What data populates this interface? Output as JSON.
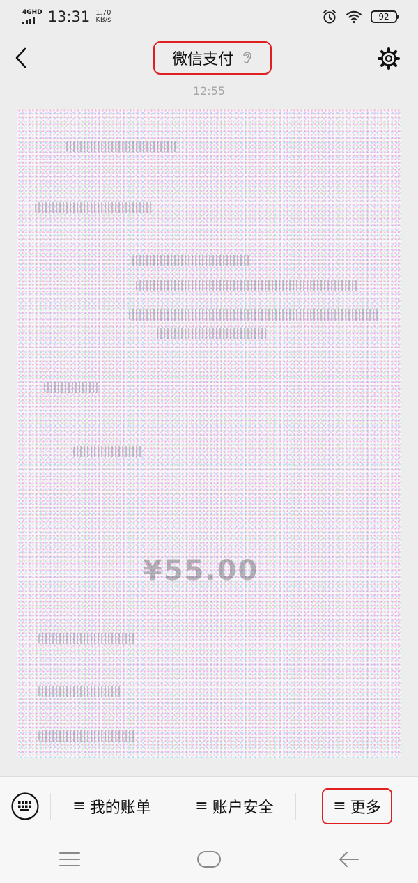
{
  "status_bar": {
    "network": "4GHD",
    "time": "13:31",
    "speed_value": "1.70",
    "speed_unit": "KB/s",
    "battery": "92"
  },
  "header": {
    "title": "微信支付",
    "icons": [
      "back-arrow-icon",
      "ear-icon",
      "settings-gear-icon"
    ]
  },
  "chat": {
    "timestamp": "12:55",
    "amount_text": "¥55.00"
  },
  "menu": {
    "items": [
      {
        "glyph": "≡",
        "label": "我的账单"
      },
      {
        "glyph": "≡",
        "label": "账户安全"
      },
      {
        "glyph": "≡",
        "label": "更多"
      }
    ],
    "keyboard_icon": "keyboard-icon"
  },
  "nav": {
    "icons": [
      "menu-icon",
      "home-icon",
      "back-icon"
    ]
  },
  "colors": {
    "highlight": "#e02020",
    "background": "#ededed",
    "timestamp": "#a6a6a6"
  }
}
